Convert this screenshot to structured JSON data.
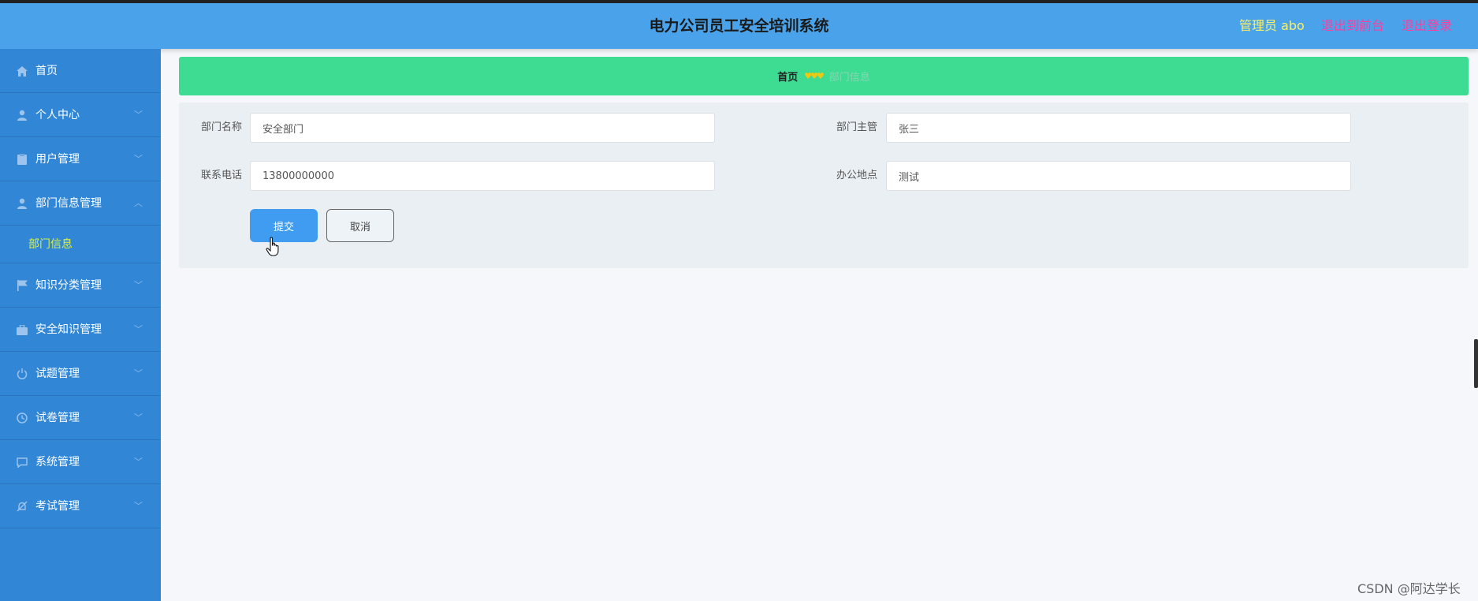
{
  "header": {
    "title": "电力公司员工安全培训系统",
    "user": "管理员 abo",
    "front_link": "退出到前台",
    "logout_link": "退出登录"
  },
  "sidebar": {
    "items": [
      {
        "label": "首页",
        "icon": "home-icon",
        "has_chevron": false
      },
      {
        "label": "个人中心",
        "icon": "user-icon",
        "has_chevron": true
      },
      {
        "label": "用户管理",
        "icon": "clipboard-icon",
        "has_chevron": true
      },
      {
        "label": "部门信息管理",
        "icon": "user-icon",
        "has_chevron": true,
        "expanded": true
      },
      {
        "label": "知识分类管理",
        "icon": "flag-icon",
        "has_chevron": true
      },
      {
        "label": "安全知识管理",
        "icon": "briefcase-icon",
        "has_chevron": true
      },
      {
        "label": "试题管理",
        "icon": "power-icon",
        "has_chevron": true
      },
      {
        "label": "试卷管理",
        "icon": "clock-icon",
        "has_chevron": true
      },
      {
        "label": "系统管理",
        "icon": "chat-icon",
        "has_chevron": true
      },
      {
        "label": "考试管理",
        "icon": "bell-off-icon",
        "has_chevron": true
      }
    ],
    "sub_item": "部门信息"
  },
  "breadcrumb": {
    "home": "首页",
    "separator": "♥♥♥",
    "current": "部门信息"
  },
  "form": {
    "dept_name_label": "部门名称",
    "dept_name_value": "安全部门",
    "manager_label": "部门主管",
    "manager_value": "张三",
    "phone_label": "联系电话",
    "phone_value": "13800000000",
    "office_label": "办公地点",
    "office_value": "测试",
    "submit_label": "提交",
    "cancel_label": "取消"
  },
  "watermark": "CSDN @阿达学长",
  "colors": {
    "header_bg": "#4aa3ea",
    "sidebar_bg": "#3187d6",
    "breadcrumb_bg": "#3edc93",
    "user_text": "#f7f06b",
    "link_text": "#ff3d9d",
    "submenu_active": "#d8f04a",
    "submit_bg": "#3f9cf0"
  }
}
